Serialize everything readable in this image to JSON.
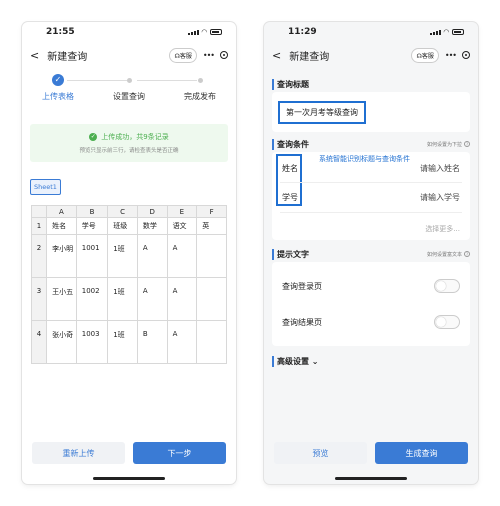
{
  "left": {
    "status": {
      "time": "21:55"
    },
    "nav": {
      "title": "新建查询",
      "service": "客服",
      "back": "<"
    },
    "steps": [
      {
        "label": "上传表格"
      },
      {
        "label": "设置查询"
      },
      {
        "label": "完成发布"
      }
    ],
    "success": {
      "main": "上传成功，共9条记录",
      "sub": "预览只显示前三行，请检查表头是否正确"
    },
    "sheet_tab": "Sheet1",
    "table": {
      "col_letters": [
        "A",
        "B",
        "C",
        "D",
        "E",
        "F"
      ],
      "rows": [
        {
          "num": "1",
          "cells": [
            "姓名",
            "学号",
            "班级",
            "数学",
            "语文",
            "英"
          ]
        },
        {
          "num": "2",
          "cells": [
            "李小明",
            "1001",
            "1班",
            "A",
            "A",
            ""
          ]
        },
        {
          "num": "3",
          "cells": [
            "王小五",
            "1002",
            "1班",
            "A",
            "A",
            ""
          ]
        },
        {
          "num": "4",
          "cells": [
            "张小奇",
            "1003",
            "1班",
            "B",
            "A",
            ""
          ]
        }
      ]
    },
    "buttons": {
      "reupload": "重新上传",
      "next": "下一步"
    }
  },
  "right": {
    "status": {
      "time": "11:29"
    },
    "nav": {
      "title": "新建查询",
      "service": "客服",
      "back": "<"
    },
    "title_section": {
      "label": "查询标题",
      "value": "第一次月考等级查询"
    },
    "cond_section": {
      "label": "查询条件",
      "hint": "如何设置为下拉",
      "annotation": "系统智能识别标题与查询条件",
      "rows": [
        {
          "label": "姓名",
          "placeholder": "请输入姓名"
        },
        {
          "label": "学号",
          "placeholder": "请输入学号"
        }
      ],
      "more": "选择更多..."
    },
    "tip_section": {
      "label": "提示文字",
      "hint": "如何设置富文本",
      "rows": [
        {
          "label": "查询登录页"
        },
        {
          "label": "查询结果页"
        }
      ]
    },
    "advanced": "高级设置",
    "buttons": {
      "preview": "预览",
      "generate": "生成查询"
    }
  },
  "colors": {
    "accent": "#3a7bd5",
    "success": "#4caf50",
    "highlight": "#1f6fd1"
  }
}
